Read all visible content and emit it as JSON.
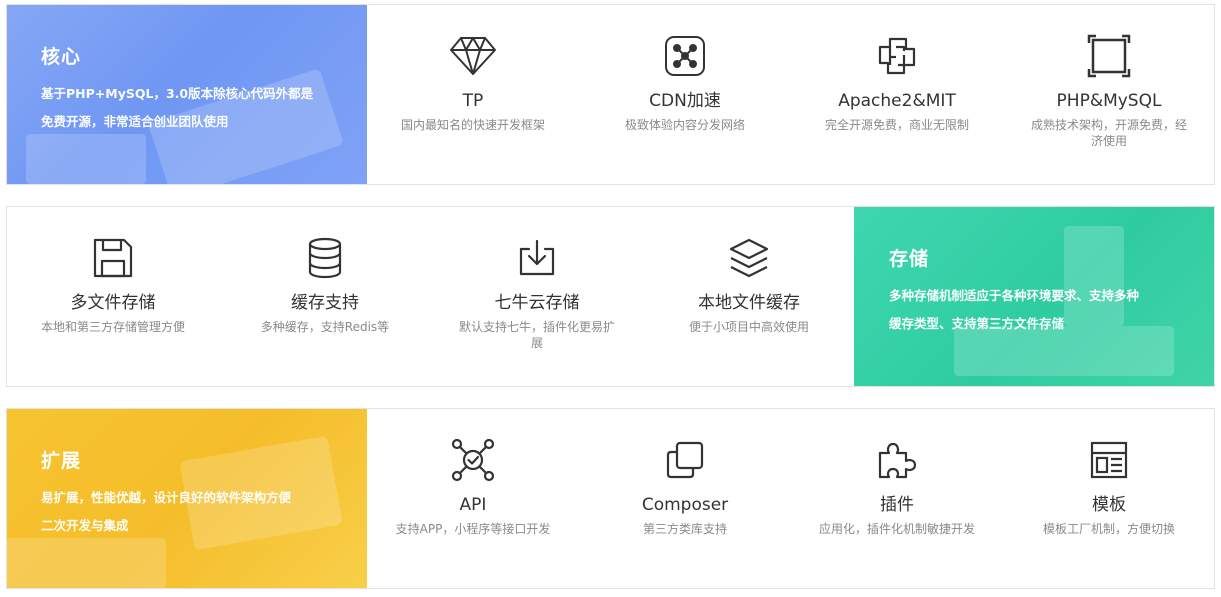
{
  "rows": [
    {
      "feature": {
        "title": "核心",
        "desc_line1": "基于PHP+MySQL，3.0版本除核心代码外都是",
        "desc_line2": "免费开源，非常适合创业团队使用",
        "color": "#7a9ff5"
      },
      "items": [
        {
          "icon": "diamond-icon",
          "title": "TP",
          "desc": "国内最知名的快速开发框架"
        },
        {
          "icon": "network-nodes-icon",
          "title": "CDN加速",
          "desc": "极致体验内容分发网络"
        },
        {
          "icon": "linked-squares-icon",
          "title": "Apache2&MIT",
          "desc": "完全开源免费，商业无限制"
        },
        {
          "icon": "frame-corners-icon",
          "title": "PHP&MySQL",
          "desc": "成熟技术架构，开源免费，经济使用"
        }
      ]
    },
    {
      "feature": {
        "title": "存储",
        "desc_line1": "多种存储机制适应于各种环境要求、支持多种",
        "desc_line2": "缓存类型、支持第三方文件存储",
        "color": "#33d0a5"
      },
      "items": [
        {
          "icon": "floppy-disk-icon",
          "title": "多文件存储",
          "desc": "本地和第三方存储管理方便"
        },
        {
          "icon": "database-icon",
          "title": "缓存支持",
          "desc": "多种缓存，支持Redis等"
        },
        {
          "icon": "download-tray-icon",
          "title": "七牛云存储",
          "desc": "默认支持七牛，插件化更易扩展"
        },
        {
          "icon": "layers-icon",
          "title": "本地文件缓存",
          "desc": "便于小项目中高效使用"
        }
      ]
    },
    {
      "feature": {
        "title": "扩展",
        "desc_line1": "易扩展，性能优越，设计良好的软件架构方便",
        "desc_line2": "二次开发与集成",
        "color": "#f6c22f"
      },
      "items": [
        {
          "icon": "api-hub-icon",
          "title": "API",
          "desc": "支持APP，小程序等接口开发"
        },
        {
          "icon": "copy-icon",
          "title": "Composer",
          "desc": "第三方类库支持"
        },
        {
          "icon": "puzzle-piece-icon",
          "title": "插件",
          "desc": "应用化，插件化机制敏捷开发"
        },
        {
          "icon": "template-layout-icon",
          "title": "模板",
          "desc": "模板工厂机制，方便切换"
        }
      ]
    }
  ]
}
